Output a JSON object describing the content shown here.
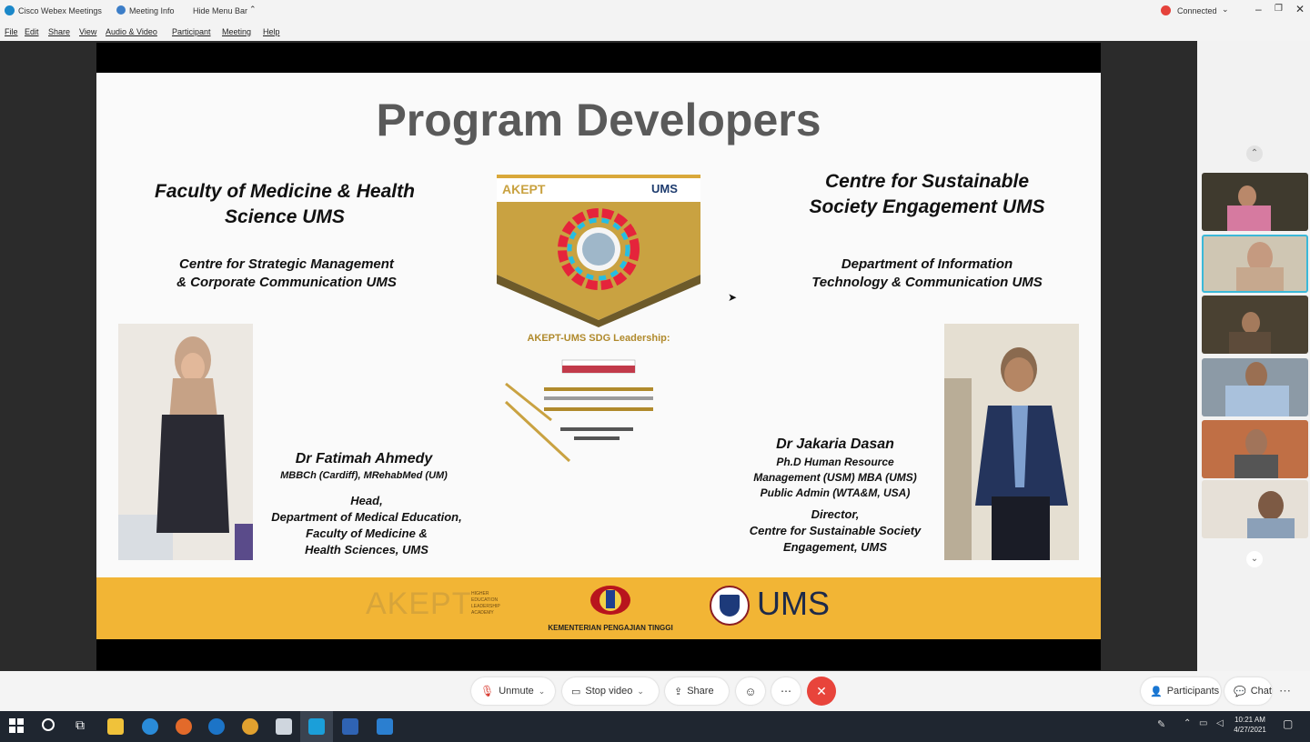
{
  "titlebar": {
    "app_title": "Cisco Webex Meetings",
    "meeting_info": "Meeting Info",
    "hide_menu_bar": "Hide Menu Bar",
    "connection_status": "Connected"
  },
  "menu": [
    "File",
    "Edit",
    "Share",
    "View",
    "Audio & Video",
    "Participant",
    "Meeting",
    "Help"
  ],
  "slide": {
    "title": "Program Developers",
    "left_heading": "Faculty of Medicine & Health Science UMS",
    "left_sub_line1": "Centre for Strategic Management",
    "left_sub_line2": "& Corporate Communication UMS",
    "right_heading_line1": "Centre for Sustainable",
    "right_heading_line2": "Society Engagement UMS",
    "right_sub_line1": "Department of Information",
    "right_sub_line2": "Technology & Communication UMS",
    "poster_title": "AKEPT-UMS SDG Leadership:",
    "person1_name": "Dr Fatimah Ahmedy",
    "person1_quals": "MBBCh (Cardiff), MRehabMed (UM)",
    "person1_role_lines": [
      "Head,",
      "Department of Medical Education,",
      "Faculty of Medicine &",
      "Health Sciences, UMS"
    ],
    "person2_name": "Dr Jakaria Dasan",
    "person2_quals_lines": [
      "Ph.D Human Resource",
      "Management (USM) MBA (UMS)",
      "Public Admin (WTA&M, USA)"
    ],
    "person2_role_lines": [
      "Director,",
      "Centre for Sustainable Society",
      "Engagement, UMS"
    ],
    "footer_akept": "AKEPT",
    "footer_akept_sub": "HIGHER EDUCATION LEADERSHIP ACADEMY",
    "footer_ministry": "KEMENTERIAN PENGAJIAN TINGGI",
    "footer_ums": "UMS"
  },
  "controls": {
    "unmute": "Unmute",
    "stop_video": "Stop video",
    "share": "Share",
    "participants": "Participants",
    "chat": "Chat"
  },
  "taskbar": {
    "time": "10:21 AM",
    "date": "4/27/2021"
  },
  "colors": {
    "end_call": "#e8443b",
    "footer_band": "#f2b535",
    "taskbar": "#1f2630"
  }
}
